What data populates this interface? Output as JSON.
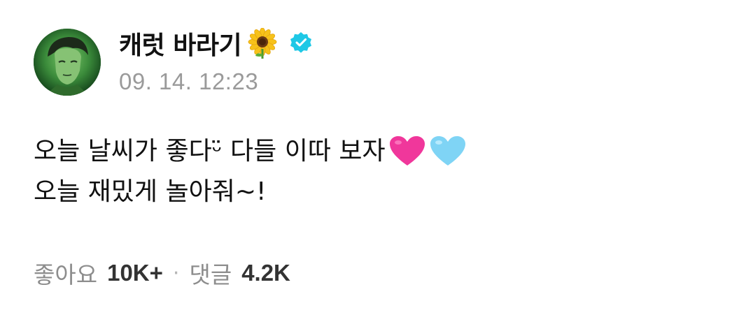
{
  "post": {
    "author": {
      "name": "캐럿 바라기",
      "name_emoji": "sunflower-icon",
      "verified": true,
      "verified_color": "#1ec8e6"
    },
    "timestamp": "09. 14. 12:23",
    "body": {
      "line1_text": "오늘 날씨가 좋다ᵕ̈ 다들 이따 보자",
      "line1_emojis": [
        "pink-heart-icon",
        "light-blue-heart-icon"
      ],
      "line2_text": "오늘 재밌게 놀아줘~!"
    },
    "stats": {
      "likes_label": "좋아요",
      "likes_value": "10K+",
      "separator": "·",
      "comments_label": "댓글",
      "comments_value": "4.2K"
    }
  }
}
